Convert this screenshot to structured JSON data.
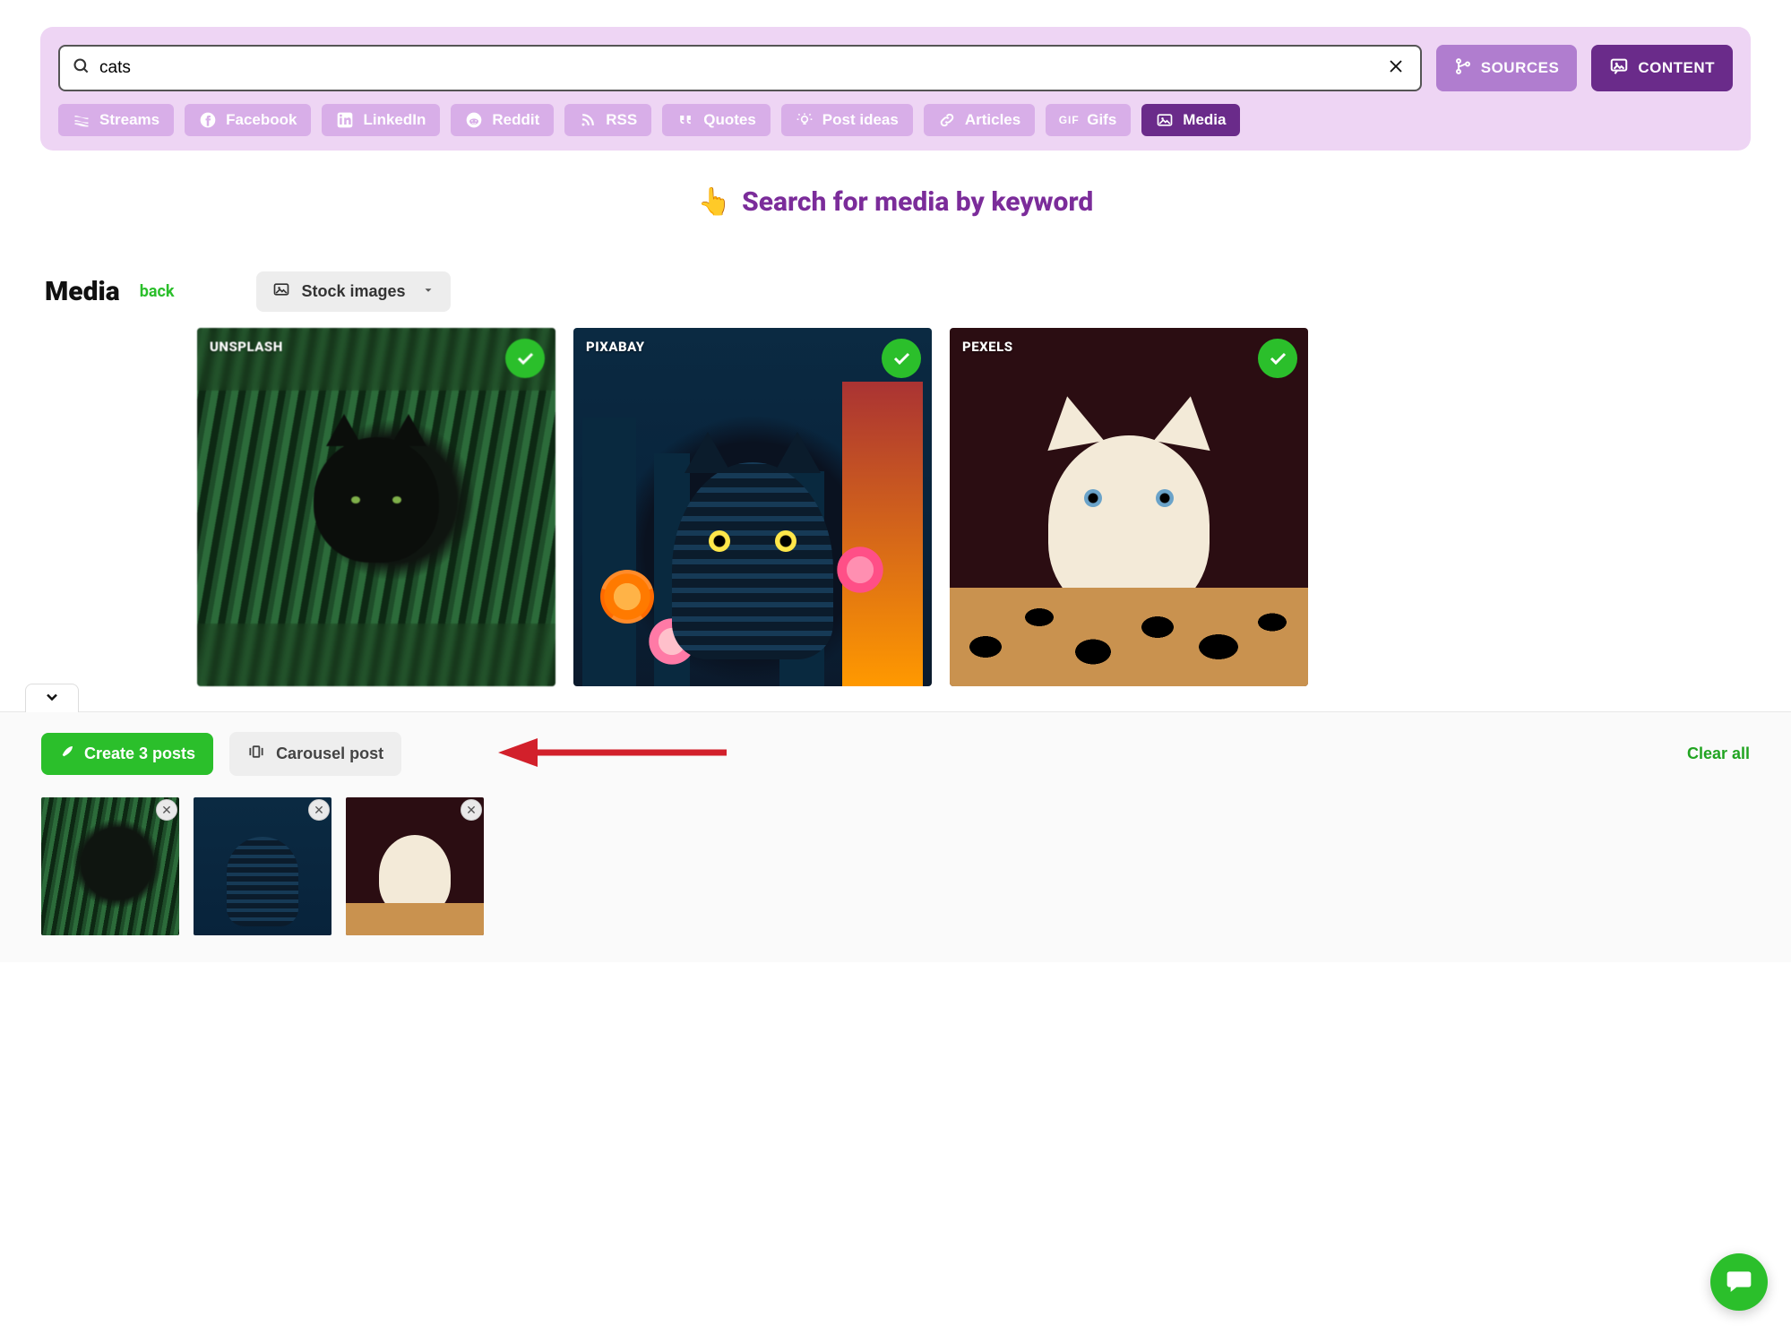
{
  "search": {
    "value": "cats",
    "placeholder": "",
    "sources_btn": "SOURCES",
    "content_btn": "CONTENT"
  },
  "chips": {
    "streams": "Streams",
    "facebook": "Facebook",
    "linkedin": "LinkedIn",
    "reddit": "Reddit",
    "rss": "RSS",
    "quotes": "Quotes",
    "post_ideas": "Post ideas",
    "articles": "Articles",
    "gifs": "Gifs",
    "gif_prefix": "GIF",
    "media": "Media"
  },
  "hero": {
    "emoji": "👆",
    "text": "Search for media by keyword"
  },
  "section": {
    "title": "Media",
    "back": "back",
    "dropdown": "Stock images"
  },
  "cards": [
    {
      "source": "UNSPLASH",
      "selected": true
    },
    {
      "source": "PIXABAY",
      "selected": true
    },
    {
      "source": "PEXELS",
      "selected": true
    }
  ],
  "bottom": {
    "create": "Create 3 posts",
    "carousel": "Carousel post",
    "clear": "Clear all",
    "thumb_count": 3
  }
}
